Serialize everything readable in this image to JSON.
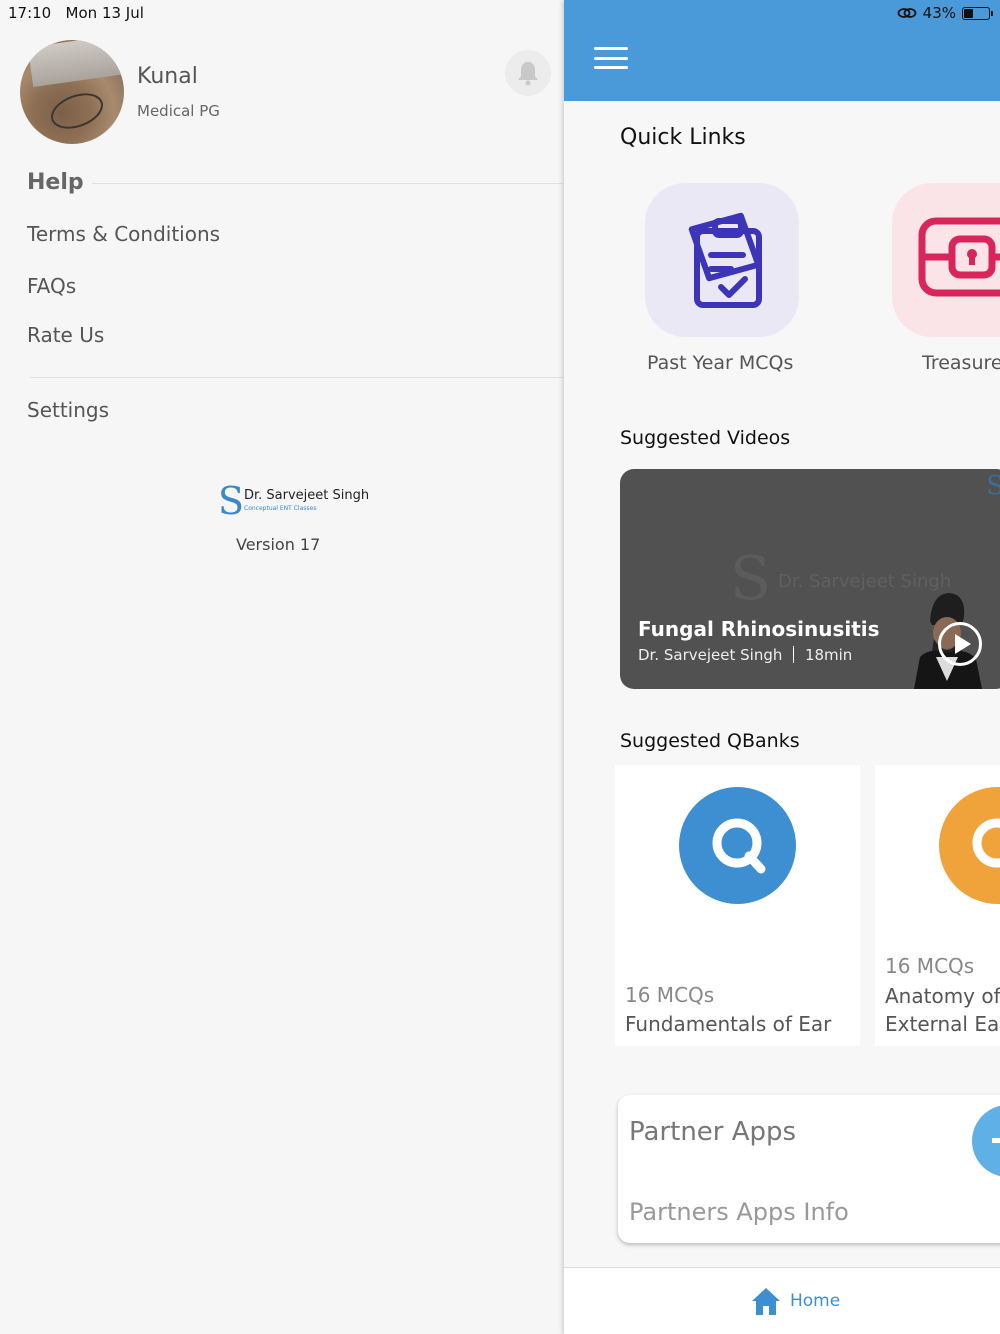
{
  "status": {
    "time": "17:10",
    "date": "Mon 13 Jul",
    "battery": "43%",
    "battery_level": 0.43
  },
  "drawer": {
    "user_name": "Kunal",
    "user_subtitle": "Medical PG",
    "help_header": "Help",
    "menu": [
      "Terms & Conditions",
      "FAQs",
      "Rate Us",
      "Settings"
    ],
    "brand_name": "Dr. Sarvejeet Singh",
    "brand_tagline": "Conceptual ENT Classes",
    "version": "Version 17"
  },
  "main": {
    "quick_links_title": "Quick Links",
    "quick_links": [
      {
        "label": "Past Year MCQs",
        "icon": "clipboard-check-icon",
        "bg": "#ebe8f5",
        "color": "#3d35b8"
      },
      {
        "label": "Treasure",
        "icon": "treasure-chest-icon",
        "bg": "#fbe4e8",
        "color": "#d8265a"
      }
    ],
    "suggested_videos_title": "Suggested Videos",
    "video": {
      "title": "Fungal Rhinosinusitis",
      "author": "Dr. Sarvejeet Singh",
      "duration": "18min",
      "watermark": "Dr. Sarvejeet Singh"
    },
    "suggested_qbanks_title": "Suggested QBanks",
    "qbanks": [
      {
        "count": "16 MCQs",
        "name_lines": [
          "Fundamentals of Ear"
        ],
        "color": "#3d8fd1"
      },
      {
        "count": "16 MCQs",
        "name_lines": [
          "Anatomy of",
          "External Ear"
        ],
        "color": "#f0a23b"
      }
    ],
    "partner": {
      "title": "Partner Apps",
      "subtitle": "Partners Apps Info"
    },
    "bottom_nav": {
      "home_label": "Home"
    }
  },
  "colors": {
    "accent": "#4a9ad9",
    "home_blue": "#3d8fd1"
  }
}
